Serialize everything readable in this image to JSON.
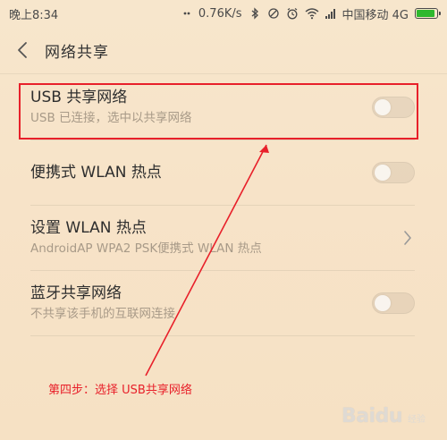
{
  "status_bar": {
    "time": "晚上8:34",
    "network_speed": "0.76K/s",
    "carrier": "中国移动 4G",
    "battery_color": "#2eb82e"
  },
  "header": {
    "back_icon": "chevron-left-icon",
    "title": "网络共享"
  },
  "settings": [
    {
      "id": "usb",
      "title": "USB 共享网络",
      "subtitle": "USB 已连接，选中以共享网络",
      "control": "toggle",
      "enabled": false
    },
    {
      "id": "wlan-hotspot",
      "title": "便携式 WLAN 热点",
      "subtitle": "",
      "control": "toggle",
      "enabled": false
    },
    {
      "id": "wlan-setup",
      "title": "设置 WLAN 热点",
      "subtitle": "AndroidAP WPA2 PSK便携式 WLAN 热点",
      "control": "chevron"
    },
    {
      "id": "bluetooth",
      "title": "蓝牙共享网络",
      "subtitle": "不共享该手机的互联网连接",
      "control": "toggle",
      "enabled": false
    }
  ],
  "annotation": {
    "text": "第四步：选择 USB共享网络",
    "color": "#e8202a"
  },
  "watermark": {
    "logo": "Baidu",
    "sub": "经验"
  }
}
